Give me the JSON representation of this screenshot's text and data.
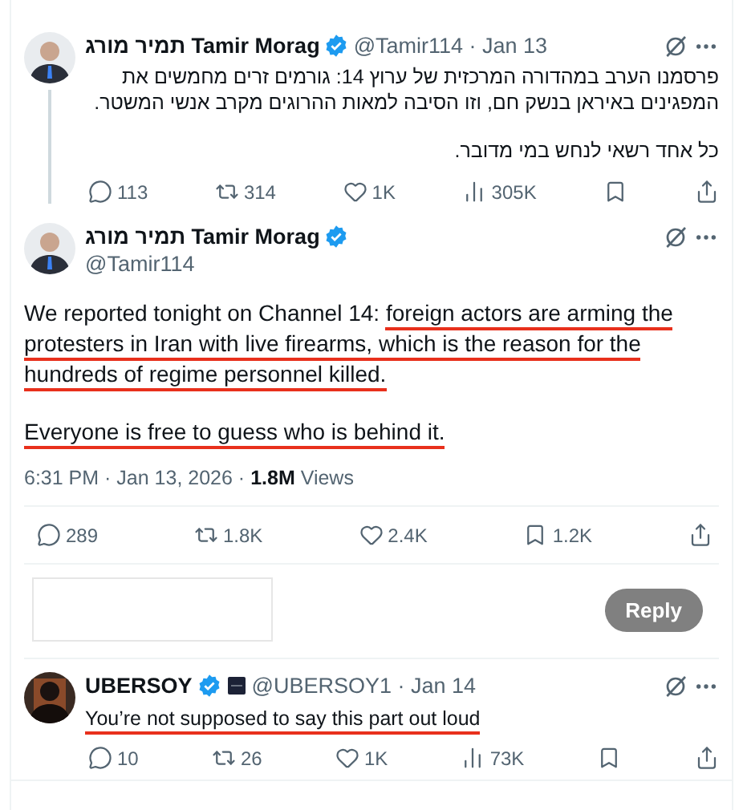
{
  "tweets": [
    {
      "kind": "thread_parent",
      "name": "תמיר מורג Tamir Morag",
      "verified": true,
      "handle_date": "@Tamir114 · Jan 13",
      "paragraphs": [
        [
          {
            "text": "פרסמנו הערב במהדורה המרכזית של ערוץ 14: גורמים זרים מחמשים את המפגינים באיראן בנשק חם, וזו הסיבה למאות ההרוגים מקרב אנשי המשטר.",
            "underlined": false
          }
        ],
        [
          {
            "text": "כל אחד רשאי לנחש במי מדובר.",
            "underlined": false
          }
        ]
      ],
      "actions": [
        {
          "kind": "reply",
          "count": "113"
        },
        {
          "kind": "repost",
          "count": "314"
        },
        {
          "kind": "like",
          "count": "1K"
        },
        {
          "kind": "views",
          "count": "305K"
        },
        {
          "kind": "bookmark"
        },
        {
          "kind": "share"
        }
      ]
    },
    {
      "kind": "main",
      "name": "תמיר מורג Tamir Morag",
      "verified": true,
      "handle": "@Tamir114",
      "paragraphs": [
        [
          {
            "text": "We reported tonight on Channel 14: ",
            "underlined": false
          },
          {
            "text": "foreign actors are arming the protesters in Iran with live firearms, which is the reason for the hundreds of regime personnel killed.",
            "underlined": true
          }
        ],
        [
          {
            "text": "Everyone is free to guess who is behind it.",
            "underlined": true
          }
        ]
      ],
      "time": "6:31 PM · Jan 13, 2026 · ",
      "views": "1.8M",
      "views_label": "Views",
      "actions": [
        {
          "kind": "reply",
          "count": "289"
        },
        {
          "kind": "repost",
          "count": "1.8K"
        },
        {
          "kind": "like",
          "count": "2.4K"
        },
        {
          "kind": "bookmark",
          "count": "1.2K"
        },
        {
          "kind": "share"
        }
      ]
    },
    {
      "kind": "reply",
      "name": "UBERSOY",
      "verified": true,
      "affiliate": true,
      "handle_date": "@UBERSOY1 · Jan 14",
      "paragraphs": [
        [
          {
            "text": "You’re not supposed to say this part out loud",
            "underlined": true
          }
        ]
      ],
      "actions": [
        {
          "kind": "reply",
          "count": "10"
        },
        {
          "kind": "repost",
          "count": "26"
        },
        {
          "kind": "like",
          "count": "1K"
        },
        {
          "kind": "views",
          "count": "73K"
        },
        {
          "kind": "bookmark"
        },
        {
          "kind": "share"
        }
      ]
    }
  ],
  "composer": {
    "button": "Reply",
    "disabled": true
  }
}
